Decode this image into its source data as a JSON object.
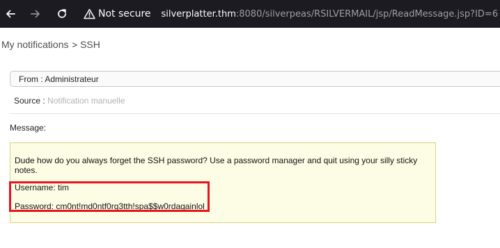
{
  "browser": {
    "security_label": "Not secure",
    "url_host": "silverplatter.thm",
    "url_rest": ":8080/silverpeas/RSILVERMAIL/jsp/ReadMessage.jsp?ID=6",
    "icons": [
      "back-arrow-icon",
      "forward-arrow-icon",
      "reload-icon",
      "warning-icon"
    ]
  },
  "breadcrumb": {
    "parent": "My notifications",
    "separator": ">",
    "current": "SSH"
  },
  "notification": {
    "from_label": "From : Administrateur",
    "source_label": "Source :",
    "source_value": "Notification manuelle",
    "message_label": "Message:",
    "message_lines": [
      "Dude how do you always forget the SSH password? Use a password manager and quit using your silly sticky notes.",
      "Username: tim",
      "Password: cm0nt!md0ntf0rg3tth!spa$$w0rdagainlol"
    ]
  },
  "colors": {
    "chrome_bg": "#1c1b22",
    "message_bg": "#fdfde6",
    "message_border": "#d9cf80",
    "highlight": "#e8141b"
  }
}
